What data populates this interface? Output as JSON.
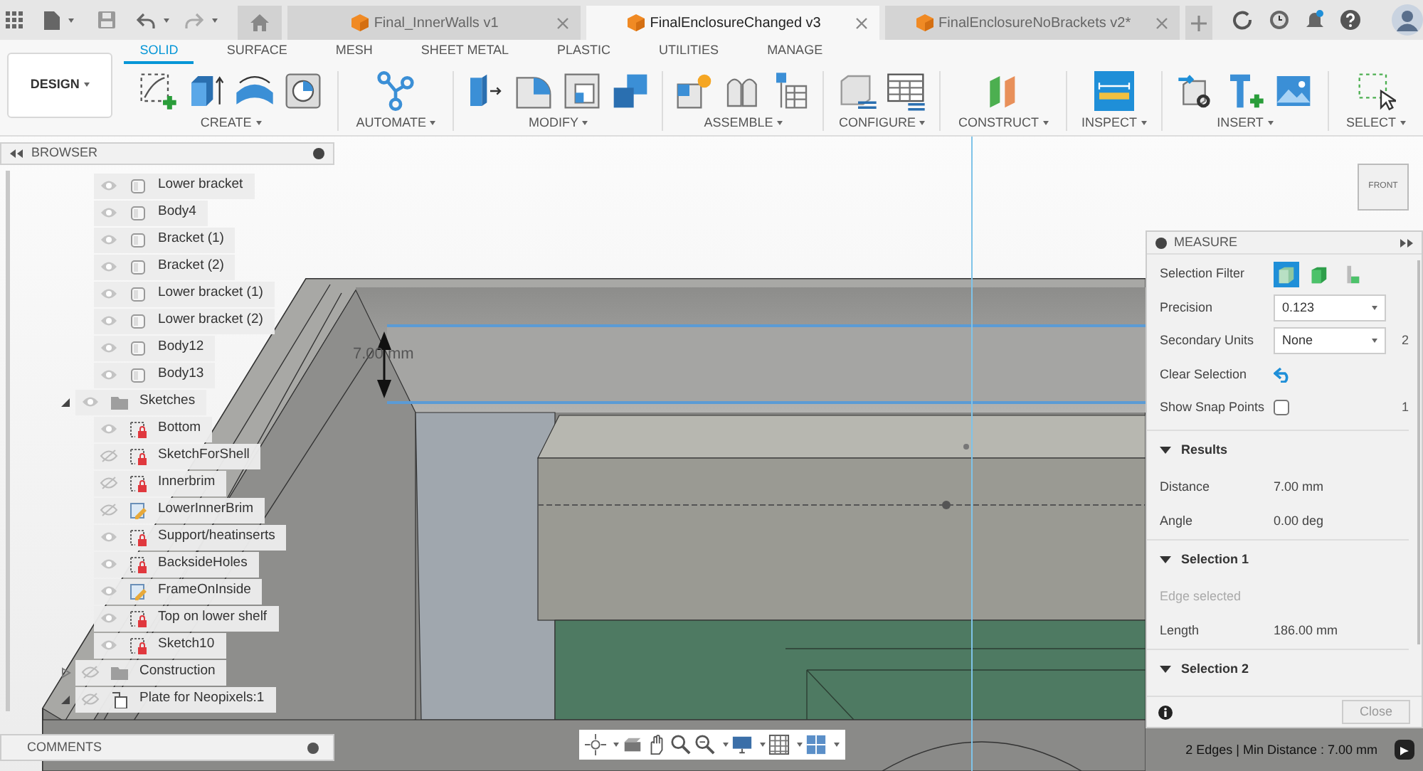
{
  "document_tabs": [
    {
      "label": "Final_InnerWalls v1",
      "selected": false
    },
    {
      "label": "FinalEnclosureChanged v3",
      "selected": true
    },
    {
      "label": "FinalEnclosureNoBrackets v2*",
      "selected": false
    }
  ],
  "workspace": {
    "label": "DESIGN"
  },
  "toolbar_tabs": [
    {
      "label": "SOLID",
      "selected": true
    },
    {
      "label": "SURFACE",
      "selected": false
    },
    {
      "label": "MESH",
      "selected": false
    },
    {
      "label": "SHEET METAL",
      "selected": false
    },
    {
      "label": "PLASTIC",
      "selected": false
    },
    {
      "label": "UTILITIES",
      "selected": false
    },
    {
      "label": "MANAGE",
      "selected": false
    }
  ],
  "toolbar_groups": [
    {
      "label": "CREATE"
    },
    {
      "label": "AUTOMATE"
    },
    {
      "label": "MODIFY"
    },
    {
      "label": "ASSEMBLE"
    },
    {
      "label": "CONFIGURE"
    },
    {
      "label": "CONSTRUCT"
    },
    {
      "label": "INSPECT"
    },
    {
      "label": "INSERT"
    },
    {
      "label": "SELECT"
    }
  ],
  "browser": {
    "title": "BROWSER",
    "body_items": [
      {
        "label": "Lower bracket",
        "kind": "body",
        "visible": true
      },
      {
        "label": "Body4",
        "kind": "body",
        "visible": true
      },
      {
        "label": "Bracket (1)",
        "kind": "body",
        "visible": true
      },
      {
        "label": "Bracket (2)",
        "kind": "body",
        "visible": true
      },
      {
        "label": "Lower bracket (1)",
        "kind": "body",
        "visible": true
      },
      {
        "label": "Lower bracket (2)",
        "kind": "body",
        "visible": true
      },
      {
        "label": "Body12",
        "kind": "body",
        "visible": true
      },
      {
        "label": "Body13",
        "kind": "body",
        "visible": true
      }
    ],
    "items": [
      {
        "label": "Sketches",
        "kind": "folder",
        "visible": true,
        "expanded": true,
        "children": [
          {
            "label": "Bottom",
            "kind": "sketch",
            "visible": true
          },
          {
            "label": "SketchForShell",
            "kind": "sketch",
            "visible": false
          },
          {
            "label": "Innerbrim",
            "kind": "sketch",
            "visible": false
          },
          {
            "label": "LowerInnerBrim",
            "kind": "draft",
            "visible": false
          },
          {
            "label": "Support/heatinserts",
            "kind": "sketch",
            "visible": true
          },
          {
            "label": "BacksideHoles",
            "kind": "sketch",
            "visible": true
          },
          {
            "label": "FrameOnInside",
            "kind": "draft",
            "visible": true
          },
          {
            "label": "Top on lower shelf",
            "kind": "sketch",
            "visible": true
          },
          {
            "label": "Sketch10",
            "kind": "sketch",
            "visible": true
          }
        ]
      },
      {
        "label": "Construction",
        "kind": "folder",
        "visible": false,
        "expanded": false
      },
      {
        "label": "Plate for Neopixels:1",
        "kind": "component",
        "visible": false,
        "expanded": true
      }
    ]
  },
  "viewcube": {
    "label": "FRONT"
  },
  "dimension": {
    "label": "7.00 mm"
  },
  "measure": {
    "title": "MEASURE",
    "rows": [
      {
        "kind": "filter",
        "label": "Selection Filter",
        "options": [
          {
            "selected": true
          },
          {
            "selected": false
          },
          {
            "selected": false
          }
        ]
      },
      {
        "kind": "select",
        "label": "Precision",
        "value": "0.123"
      },
      {
        "kind": "select",
        "label": "Secondary Units",
        "value": "None",
        "side_label": "2"
      },
      {
        "kind": "action",
        "label": "Clear Selection"
      },
      {
        "kind": "checkbox",
        "label": "Show Snap Points",
        "checked": false,
        "side_label": "1"
      }
    ],
    "sections": [
      {
        "title": "Results",
        "expanded": true,
        "rows": [
          {
            "label": "Distance",
            "value": "7.00 mm"
          },
          {
            "label": "Angle",
            "value": "0.00 deg"
          }
        ]
      },
      {
        "title": "Selection 1",
        "expanded": true,
        "note": "Edge selected",
        "rows": [
          {
            "label": "Length",
            "value": "186.00 mm"
          }
        ]
      },
      {
        "title": "Selection 2",
        "expanded": true
      }
    ],
    "close_label": "Close"
  },
  "comments": {
    "title": "COMMENTS"
  },
  "status": {
    "text": "2 Edges | Min Distance : 7.00 mm"
  }
}
